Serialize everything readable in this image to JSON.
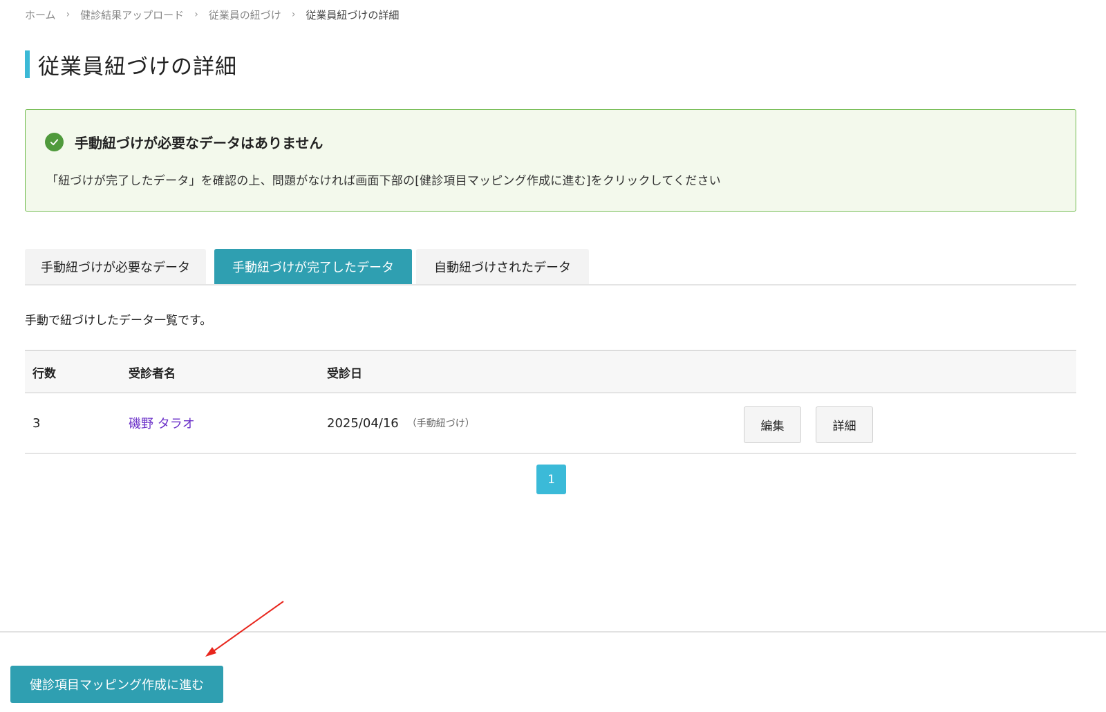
{
  "breadcrumb": {
    "items": [
      "ホーム",
      "健診結果アップロード",
      "従業員の紐づけ",
      "従業員紐づけの詳細"
    ],
    "separator": "›"
  },
  "page": {
    "title": "従業員紐づけの詳細"
  },
  "alert": {
    "title": "手動紐づけが必要なデータはありません",
    "body": "「紐づけが完了したデータ」を確認の上、問題がなければ画面下部の[健診項目マッピング作成に進む]をクリックしてください",
    "icon": "check-circle-icon",
    "color": "#4f9a3c"
  },
  "tabs": [
    {
      "label": "手動紐づけが必要なデータ",
      "active": false
    },
    {
      "label": "手動紐づけが完了したデータ",
      "active": true
    },
    {
      "label": "自動紐づけされたデータ",
      "active": false
    }
  ],
  "description": "手動で紐づけしたデータ一覧です。",
  "table": {
    "headers": {
      "row": "行数",
      "name": "受診者名",
      "date": "受診日"
    },
    "rows": [
      {
        "row": "3",
        "name": "磯野 タラオ",
        "date": "2025/04/16",
        "note": "（手動紐づけ）",
        "edit_label": "編集",
        "detail_label": "詳細"
      }
    ]
  },
  "pagination": {
    "current": "1"
  },
  "footer": {
    "primary_button": "健診項目マッピング作成に進む"
  },
  "colors": {
    "accent": "#2f9fb1",
    "title_bar": "#3bb9d6",
    "link": "#6a2fc8",
    "annotation_arrow": "#e8261d"
  }
}
